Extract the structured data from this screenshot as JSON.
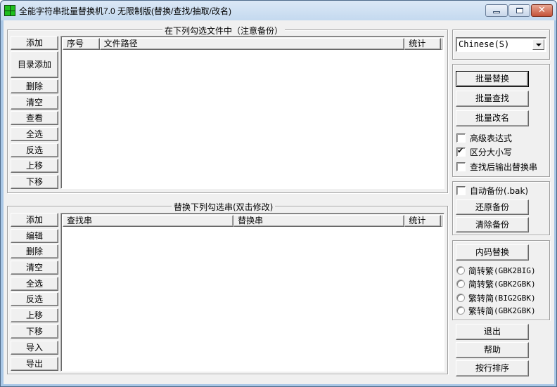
{
  "window": {
    "title": "全能字符串批量替换机7.0 无限制版(替换/查找/抽取/改名)",
    "minimize_label": "",
    "close_glyph": "✕"
  },
  "file_group": {
    "legend": "在下列勾选文件中（注意备份）",
    "buttons": [
      "添加",
      "目录添加",
      "删除",
      "清空",
      "查看",
      "全选",
      "反选",
      "上移",
      "下移"
    ],
    "columns": [
      "序号",
      "文件路径",
      "统计"
    ],
    "rows": []
  },
  "string_group": {
    "legend": "替换下列勾选串(双击修改)",
    "buttons": [
      "添加",
      "编辑",
      "删除",
      "清空",
      "全选",
      "反选",
      "上移",
      "下移",
      "导入",
      "导出"
    ],
    "columns": [
      "查找串",
      "替换串",
      "统计"
    ],
    "rows": []
  },
  "language": {
    "selected": "Chinese(S)"
  },
  "actions": {
    "batch_replace": "批量替换",
    "batch_find": "批量查找",
    "batch_rename": "批量改名",
    "options": [
      {
        "label": "高级表达式",
        "checked": false
      },
      {
        "label": "区分大小写",
        "checked": true
      },
      {
        "label": "查找后输出替换串",
        "checked": false
      }
    ]
  },
  "backup": {
    "auto_backup_label": "自动备份(.bak)",
    "auto_backup_checked": false,
    "restore": "还原备份",
    "clear": "清除备份"
  },
  "encoding": {
    "convert_button": "内码替换",
    "options": [
      {
        "label": "简转繁",
        "code": "(GBK2BIG)",
        "selected": false
      },
      {
        "label": "简转繁",
        "code": "(GBK2GBK)",
        "selected": false
      },
      {
        "label": "繁转简",
        "code": "(BIG2GBK)",
        "selected": false
      },
      {
        "label": "繁转简",
        "code": "(GBK2GBK)",
        "selected": false
      }
    ]
  },
  "bottom": {
    "exit": "退出",
    "help": "帮助",
    "sort_lines": "按行排序"
  }
}
